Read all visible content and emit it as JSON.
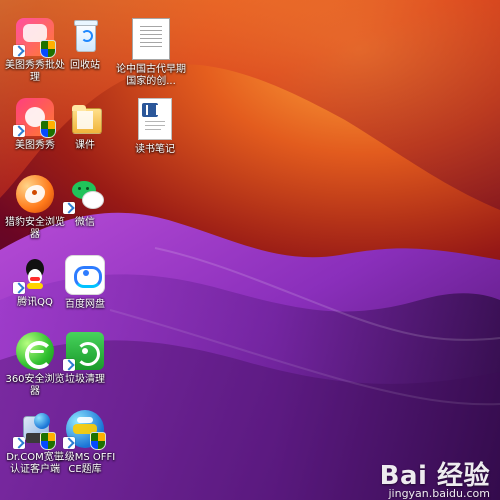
{
  "desktop": {
    "icons": [
      {
        "label": "美图秀秀批处理",
        "icon": "meitu-batch-icon"
      },
      {
        "label": "回收站",
        "icon": "recycle-bin-icon"
      },
      {
        "label": "论中国古代早期国家的创...",
        "icon": "document-icon"
      },
      {
        "label": "美图秀秀",
        "icon": "meitu-icon"
      },
      {
        "label": "课件",
        "icon": "folder-icon"
      },
      {
        "label": "读书笔记",
        "icon": "word-document-icon"
      },
      {
        "label": "猎豹安全浏览器",
        "icon": "cheetah-browser-icon"
      },
      {
        "label": "微信",
        "icon": "wechat-icon"
      },
      {
        "label": "腾讯QQ",
        "icon": "qq-icon"
      },
      {
        "label": "百度网盘",
        "icon": "baidu-netdisk-icon"
      },
      {
        "label": "360安全浏览器",
        "icon": "browser-360-icon"
      },
      {
        "label": "垃圾清理",
        "icon": "trash-cleanup-icon"
      },
      {
        "label": "Dr.COM宽带认证客户端",
        "icon": "drcom-icon"
      },
      {
        "label": "二级MS OFFICE题库",
        "icon": "office-question-bank-icon"
      }
    ]
  },
  "watermark": {
    "brand": "Bai 经验",
    "url": "jingyan.baidu.com"
  }
}
